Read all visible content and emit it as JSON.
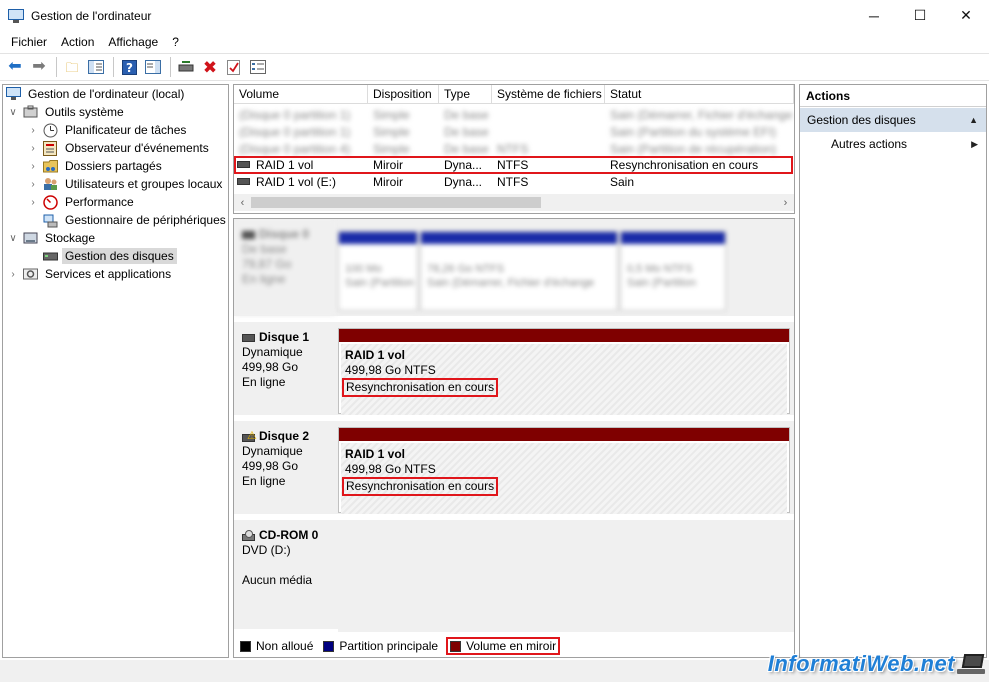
{
  "window": {
    "title": "Gestion de l'ordinateur",
    "minimize": "─",
    "maximize": "☐",
    "close": "✕"
  },
  "menu": [
    "Fichier",
    "Action",
    "Affichage",
    "?"
  ],
  "tree": {
    "root": "Gestion de l'ordinateur (local)",
    "outils": "Outils système",
    "planificateur": "Planificateur de tâches",
    "observateur": "Observateur d'événements",
    "dossiers": "Dossiers partagés",
    "utilisateurs": "Utilisateurs et groupes locaux",
    "performance": "Performance",
    "peripheriques": "Gestionnaire de périphériques",
    "stockage": "Stockage",
    "disques": "Gestion des disques",
    "services": "Services et applications"
  },
  "volumes": {
    "headers": [
      "Volume",
      "Disposition",
      "Type",
      "Système de fichiers",
      "Statut"
    ],
    "blurred_rows": [
      [
        "(Disque 0 partition 1)",
        "Simple",
        "De base",
        "",
        "Sain (Démarrer, Fichier d'échange"
      ],
      [
        "(Disque 0 partition 1)",
        "Simple",
        "De base",
        "",
        "Sain (Partition du système EFI)"
      ],
      [
        "(Disque 0 partition 4)",
        "Simple",
        "De base",
        "NTFS",
        "Sain (Partition de récupération)"
      ]
    ],
    "rows": [
      [
        "RAID 1 vol",
        "Miroir",
        "Dyna...",
        "NTFS",
        "Resynchronisation en cours"
      ],
      [
        "RAID 1 vol (E:)",
        "Miroir",
        "Dyna...",
        "NTFS",
        "Sain"
      ]
    ]
  },
  "disk0": {
    "name": "Disque 0",
    "lines": [
      "De base",
      "79,87 Go",
      "En ligne"
    ],
    "parts": [
      [
        "100 Mo",
        "Sain (Partition"
      ],
      [
        "78,26 Go NTFS",
        "Sain (Démarrer, Fichier d'échange"
      ],
      [
        "0,5 Mo NTFS",
        "Sain (Partition"
      ]
    ]
  },
  "disk1": {
    "name": "Disque 1",
    "type": "Dynamique",
    "size": "499,98 Go",
    "state": "En ligne",
    "vol_name": "RAID 1 vol",
    "vol_size": "499,98 Go NTFS",
    "vol_status": "Resynchronisation en cours"
  },
  "disk2": {
    "name": "Disque 2",
    "type": "Dynamique",
    "size": "499,98 Go",
    "state": "En ligne",
    "vol_name": "RAID 1 vol",
    "vol_size": "499,98 Go NTFS",
    "vol_status": "Resynchronisation en cours"
  },
  "cdrom": {
    "name": "CD-ROM 0",
    "type": "DVD (D:)",
    "media": "Aucun média"
  },
  "legend": [
    "Non alloué",
    "Partition principale",
    "Volume en miroir"
  ],
  "legend_colors": {
    "unallocated": "#000000",
    "primary": "#00007f",
    "mirror": "#7f0000"
  },
  "actions": {
    "header": "Actions",
    "section": "Gestion des disques",
    "item": "Autres actions"
  },
  "watermark": "InformatiWeb.net",
  "colors": {
    "highlight": "#e0161b",
    "section_bg": "#d5e0ec"
  }
}
